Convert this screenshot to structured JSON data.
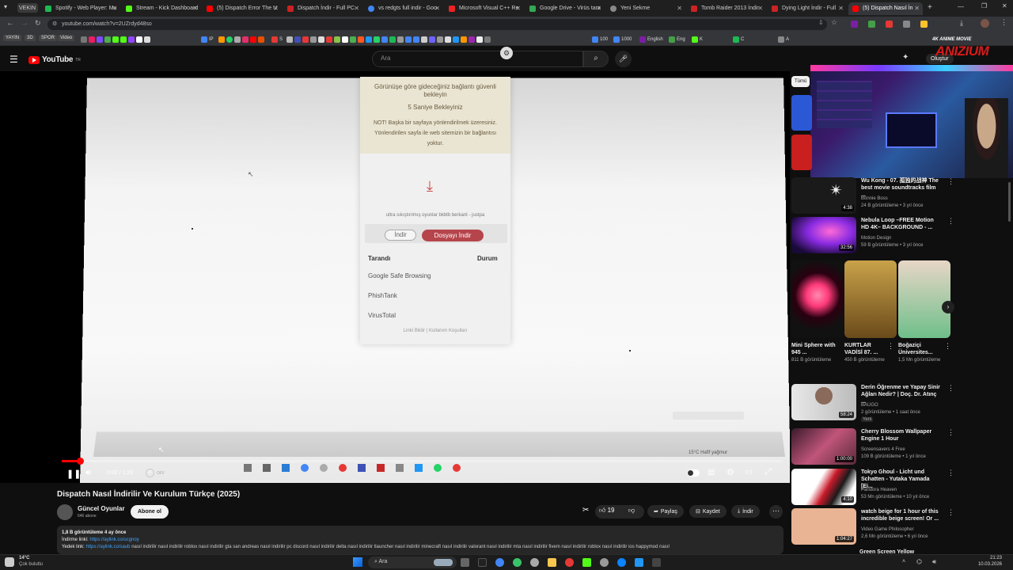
{
  "tabs": [
    {
      "label": "VEKIN",
      "color": "#666"
    },
    {
      "label": "Spotify - Web Player: Mu",
      "color": "#1db954"
    },
    {
      "label": "Stream - Kick Dashboard",
      "color": "#53fc18"
    },
    {
      "label": "(5) Dispatch Error The U",
      "color": "#ff0000"
    },
    {
      "label": "Dispatch İndir - Full PC",
      "color": "#cc2222"
    },
    {
      "label": "vs redgts full indir - Goo",
      "color": "#4285f4"
    },
    {
      "label": "Microsoft Visual C++ Re",
      "color": "#e22"
    },
    {
      "label": "Google Drive - Virüs tara",
      "color": "#34a853"
    },
    {
      "label": "Yeni Sekme",
      "color": "#888"
    },
    {
      "label": "Tomb Raider 2013 İndir",
      "color": "#cc2222"
    },
    {
      "label": "Dying Light İndir - Full",
      "color": "#cc2222"
    },
    {
      "label": "(5) Dispatch Nasıl İn",
      "color": "#ff0000"
    }
  ],
  "url": "youtube.com/watch?v=2UZrdyd48so",
  "bookmarks": [
    {
      "label": "YAYIN",
      "color": "#444"
    },
    {
      "label": "3D",
      "color": "#444"
    },
    {
      "label": "SPOR",
      "color": "#444"
    },
    {
      "label": "Video",
      "color": "#444"
    },
    {
      "label": "IP",
      "color": "#4285f4"
    },
    {
      "label": "S",
      "color": "#e53935"
    },
    {
      "label": "100",
      "color": "#4285f4"
    },
    {
      "label": "1000",
      "color": "#4285f4"
    },
    {
      "label": "English",
      "color": "#7b1fa2"
    },
    {
      "label": "Eng",
      "color": "#43a047"
    },
    {
      "label": "K",
      "color": "#53fc18"
    },
    {
      "label": "C",
      "color": "#1db954"
    },
    {
      "label": "A",
      "color": "#888"
    }
  ],
  "youtube": {
    "logo": "YouTube",
    "country": "TR",
    "search_placeholder": "Ara",
    "create": "Oluştur",
    "watermark_top": "4K ANIME MOVIE",
    "watermark_brand": "ANIZIUM"
  },
  "popup": {
    "line1": "Görünüşe göre gideceğiniz bağlantı güvenli bekleyin",
    "wait": "5 Saniye Bekleyiniz",
    "note": "NOT! Başka bir sayfaya yönlendirilmek üzeresiniz. Yönlendirilen sayfa ile web sitemizin bir bağlantısı yoktur.",
    "file": "ultra sıkıştırılmış oyunlar bkbtb berkant - justpa",
    "btn_indir": "İndir",
    "btn_dosya": "Dosyayı İndir",
    "col_scanned": "Tarandı",
    "col_status": "Durum",
    "rows": [
      "Google Safe Browsing",
      "PhishTank",
      "VirusTotal"
    ],
    "footer": "Linki Bildir | Kullanım Koşulları"
  },
  "screen_misc": {
    "weather": "15°C  Hafif yağmur"
  },
  "player": {
    "time": "0:02 / 1:20",
    "autoplay": "OFF",
    "progress": 0.025
  },
  "video": {
    "title": "Dispatch Nasıl İndirilir Ve Kurulum Türkçe (2025)",
    "channel": "Güncel Oyunlar",
    "subs": "646 abone",
    "subscribe": "Abone ol",
    "likes": "19",
    "share": "Paylaş",
    "save": "Kaydet",
    "download": "İndir",
    "views_line": "1,8 B görüntüleme  4 ay önce",
    "link_label": "İndirme linki:",
    "link_url": "https://aylink.co/ucgnoy",
    "link2_label": "Yedek link:",
    "link2_url": "https://aylink.co/saub",
    "tags": "nasıl indirilir nasıl indirilir roblox nasıl indirilir gta san andreas nasıl indirilir pc discord nasıl indirilir delta nasıl indirilir tlauncher nasıl indirilir minecraft nasıl indirilir valorant nasıl indirilir mta nasıl indirilir fivem nasıl indirilir roblox nasıl indirilir ios happymod nasıl"
  },
  "sidebar": {
    "chip": "Tümü",
    "cards": [
      {
        "title": "Wu Kong - 07. 孤独的战神 The best movie soundtracks film ...",
        "channel": "Bonnie Boss",
        "meta": "24 B görüntüleme • 3 yıl önce",
        "duration": "4:38",
        "thumb": "#2a2a2a"
      },
      {
        "title": "Nebula Loop –FREE Motion HD 4K– BACKGROUND - ...",
        "channel": "Motion Design",
        "meta": "59 B görüntüleme • 3 yıl önce",
        "duration": "32:56",
        "thumb": "#5b1d8c"
      },
      {
        "title": "Derin Öğrenme ve Yapay Sinir Ağları Nedir? | Doç. Dr. Atınç ...",
        "channel": "BAUGO",
        "meta": "2 görüntüleme • 1 saat önce",
        "badge": "Yeni",
        "duration": "58:24",
        "thumb": "#d9d9d9"
      },
      {
        "title": "Cherry Blossom Wallpaper Engine 1 Hour",
        "channel": "Screensavers 4 Free",
        "meta": "109 B görüntüleme • 1 yıl önce",
        "duration": "1:00:00",
        "thumb": "#a64d6d"
      },
      {
        "title": "Tokyo Ghoul - Licht und Schatten - Yutaka Yamada [Ei...",
        "channel": "Pandora Heaven",
        "meta": "53 Mn görüntüleme • 10 yıl önce",
        "duration": "4:10",
        "thumb": "#e8e8e8"
      },
      {
        "title": "watch beige for 1 hour of this incredible beige screen! Or ...",
        "channel": "Video Game Philosopher",
        "meta": "2,6 Mn görüntüleme • 6 yıl önce",
        "duration": "1:04:27",
        "thumb": "#e8b493"
      }
    ],
    "shorts": [
      {
        "title": "Mini Sphere with 945 ...",
        "meta": "811 B görüntüleme",
        "color": "#ff6699"
      },
      {
        "title": "KURTLAR VADİSİ 87. ...",
        "meta": "450 B görüntüleme",
        "color": "#8a6a2a"
      },
      {
        "title": "Boğaziçi Üniversites...",
        "meta": "1,5 Mn görüntüleme",
        "color": "#9fbfa0"
      }
    ],
    "last_title": "Green Screen Yellow"
  },
  "taskbar": {
    "weather_temp": "14°C",
    "weather_text": "Çok bulutlu",
    "search": "Ara",
    "time": "21:23",
    "date": "10.03.2026"
  }
}
